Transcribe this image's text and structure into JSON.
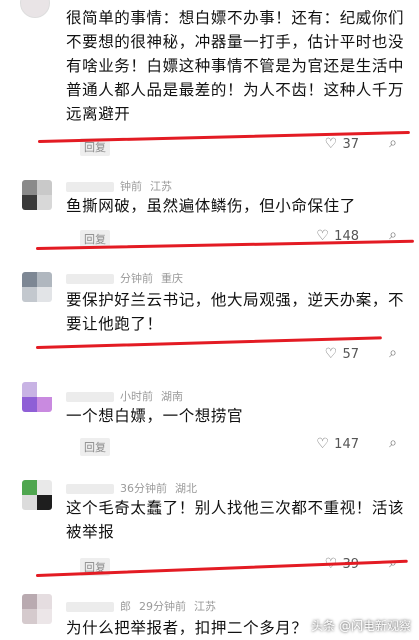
{
  "comments": [
    {
      "text": "很简单的事情：想白嫖不办事！还有：纪威你们不要想的很神秘，冲器量一打手，估计平时也没有啥业务！白嫖这种事情不管是为官还是生活中普通人都人品是最差的！为人不齿！这种人千万远离避开",
      "time": "",
      "location": "",
      "reply_label": "回复",
      "likes": "37"
    },
    {
      "text": "鱼撕网破，虽然遍体鳞伤，但小命保住了",
      "time": "钟前",
      "location": "江苏",
      "reply_label": "回复",
      "likes": "148",
      "avatar_colors": [
        "#8a8a8a",
        "#c9c9c9",
        "#3a3a3a",
        "#d8d8d8"
      ]
    },
    {
      "text": "要保护好兰云书记，他大局观强，逆天办案，不要让他跑了！",
      "time": "分钟前",
      "location": "重庆",
      "reply_label": "回复",
      "likes": "57",
      "avatar_colors": [
        "#7d8794",
        "#b0b7bf",
        "#c3c8ce",
        "#e2e4e7"
      ]
    },
    {
      "text": "一个想白嫖，一个想捞官",
      "time": "小时前",
      "location": "湖南",
      "reply_label": "回复",
      "likes": "147",
      "avatar_colors": [
        "#c8b3e4",
        "#ffffff",
        "#8f5fd6",
        "#c98ae0"
      ]
    },
    {
      "text": "这个毛奇太蠢了！别人找他三次都不重视！活该被举报",
      "time": "36分钟前",
      "location": "湖北",
      "reply_label": "回复",
      "likes": "39",
      "avatar_colors": [
        "#4fa64f",
        "#e9e9e9",
        "#dcdcdc",
        "#1e1e1e"
      ]
    },
    {
      "text": "为什么把举报者，扣押二个多月？",
      "time": "29分钟前",
      "location": "江苏",
      "author_partial": "郎",
      "reply_label": "",
      "likes": "",
      "avatar_colors": [
        "#b9aab0",
        "#e5dde0",
        "#d5cacd",
        "#ece6e8"
      ]
    }
  ],
  "watermark": "头条 @闪电新观察",
  "colors": {
    "highlight": "#e31b23"
  }
}
